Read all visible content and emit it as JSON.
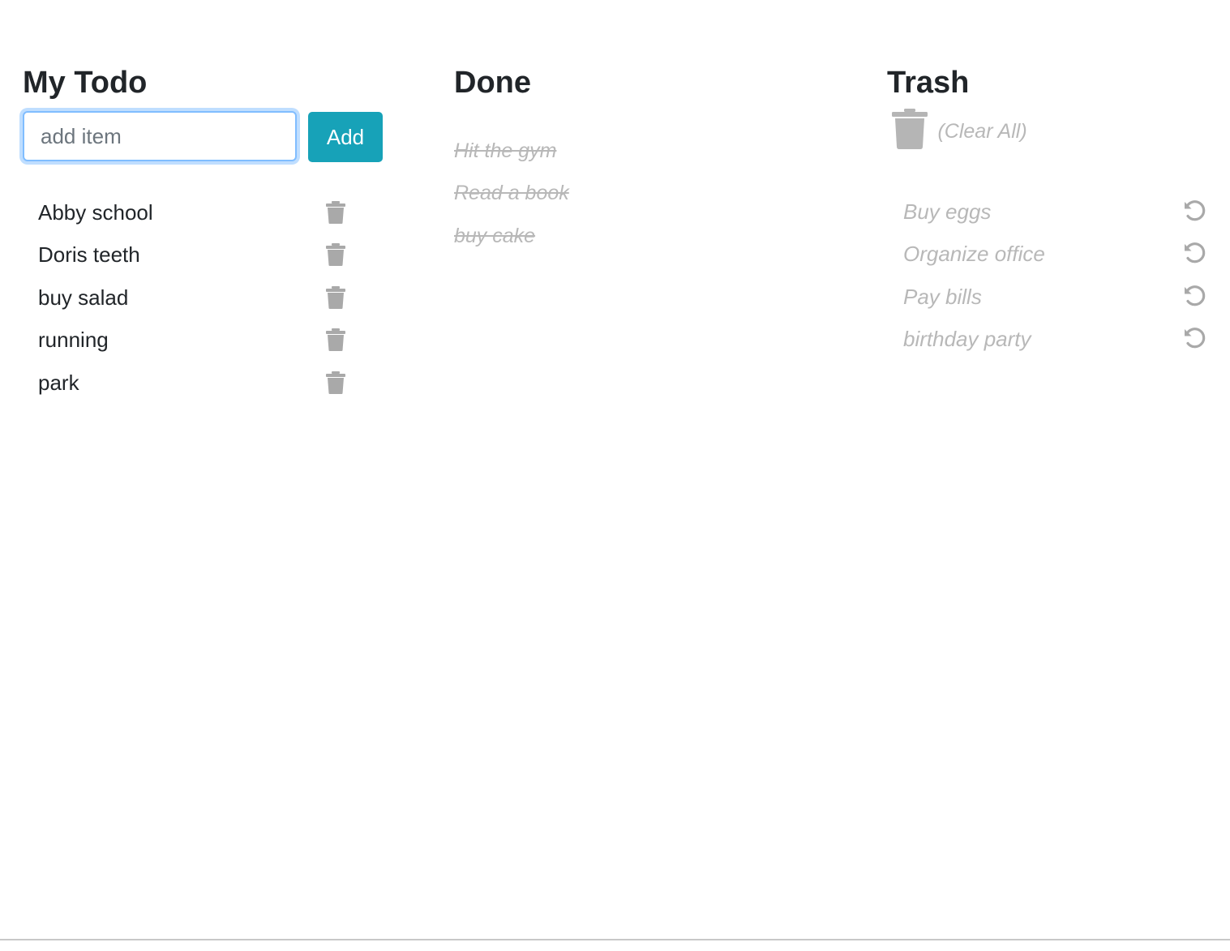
{
  "todo": {
    "title": "My Todo",
    "input_value": "",
    "input_placeholder": "add item",
    "add_label": "Add",
    "items": [
      {
        "label": "Abby school",
        "icon": "trash-icon"
      },
      {
        "label": "Doris teeth",
        "icon": "trash-icon"
      },
      {
        "label": "buy salad",
        "icon": "trash-icon"
      },
      {
        "label": "running",
        "icon": "trash-icon"
      },
      {
        "label": "park",
        "icon": "trash-icon"
      }
    ]
  },
  "done": {
    "title": "Done",
    "items": [
      {
        "label": "Hit the gym"
      },
      {
        "label": "Read a book"
      },
      {
        "label": "buy cake"
      }
    ]
  },
  "trash": {
    "title": "Trash",
    "clear_icon": "trash-icon",
    "clear_label": "(Clear All)",
    "items": [
      {
        "label": "Buy eggs",
        "icon": "undo-icon"
      },
      {
        "label": "Organize office",
        "icon": "undo-icon"
      },
      {
        "label": "Pay bills",
        "icon": "undo-icon"
      },
      {
        "label": "birthday party",
        "icon": "undo-icon"
      }
    ]
  },
  "colors": {
    "accent": "#17a2b8",
    "focus_border": "#80bdff",
    "muted_text": "#b8b8b8",
    "icon_gray": "#a9a9a9",
    "text": "#212529"
  }
}
